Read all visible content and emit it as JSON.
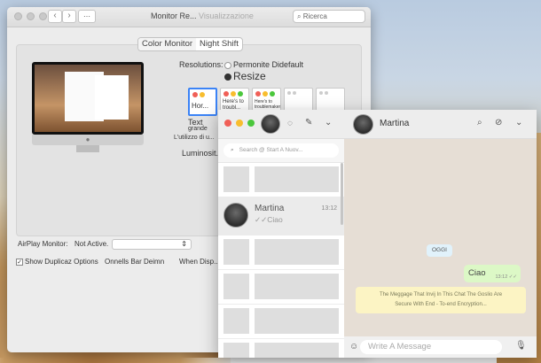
{
  "display_prefs": {
    "window_title": "Monitor Re...",
    "title_overlap": "Visualizzazione",
    "search_placeholder": "Ricerca",
    "tabs": [
      "Color Monitor",
      "Night Shift"
    ],
    "resolution_label": "Resolutions:",
    "option_default": "Permonite Didefault",
    "option_resize": "Resize",
    "res_opts": [
      "Hor...",
      "Here's to troubl...",
      "Here's to troublemakers, the...",
      "",
      ""
    ],
    "text_label": "Text",
    "grande_label": "grande",
    "usage_label": "L'utilizzo di u...",
    "luminosity_label": "Luminosit...",
    "airplay_label": "AirPlay Monitor:",
    "airplay_value": "Not Active.",
    "checkbox_label": "Show Duplicaz Options",
    "bar_label": "Onnells Bar Deimn",
    "when_label": "When Disp..."
  },
  "whatsapp": {
    "search_placeholder": "Search @ Start A Nuov...",
    "chat_name": "Martina",
    "chat_time": "13:12",
    "chat_preview": "Ciao",
    "header_name": "Martina",
    "date_chip": "OGGI",
    "message_text": "Ciao",
    "message_time": "13:12",
    "encryption_notice_1": "The Meggage That Invij In This Chat The Goslio Are",
    "encryption_notice_2": "Secure With End - To-end Encryption...",
    "composer_placeholder": "Write A Message"
  },
  "colors": {
    "whatsapp_bubble": "#dcf8c6",
    "whatsapp_chat_bg": "#e6ded5",
    "selection_blue": "#3b83f6"
  }
}
